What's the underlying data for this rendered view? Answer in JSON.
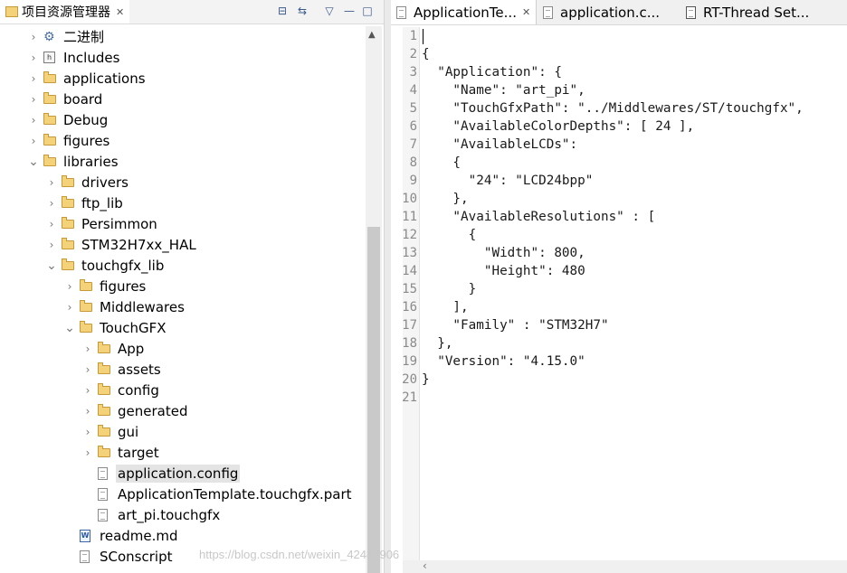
{
  "explorer": {
    "title": "项目资源管理器",
    "close_glyph": "✕",
    "toolbar": {
      "collapse_glyph": "⊟",
      "link_glyph": "⇆",
      "menu_glyph": "▽",
      "minimize_glyph": "—",
      "maximize_glyph": "□"
    },
    "items": [
      {
        "label": "二进制",
        "depth": 1,
        "expanded": false,
        "icon": "binaries-icon"
      },
      {
        "label": "Includes",
        "depth": 1,
        "expanded": false,
        "icon": "includes-icon"
      },
      {
        "label": "applications",
        "depth": 1,
        "expanded": false,
        "icon": "folder-icon"
      },
      {
        "label": "board",
        "depth": 1,
        "expanded": false,
        "icon": "folder-icon"
      },
      {
        "label": "Debug",
        "depth": 1,
        "expanded": false,
        "icon": "folder-icon"
      },
      {
        "label": "figures",
        "depth": 1,
        "expanded": false,
        "icon": "folder-icon"
      },
      {
        "label": "libraries",
        "depth": 1,
        "expanded": true,
        "icon": "folder-icon"
      },
      {
        "label": "drivers",
        "depth": 2,
        "expanded": false,
        "icon": "folder-icon"
      },
      {
        "label": "ftp_lib",
        "depth": 2,
        "expanded": false,
        "icon": "folder-icon"
      },
      {
        "label": "Persimmon",
        "depth": 2,
        "expanded": false,
        "icon": "folder-icon"
      },
      {
        "label": "STM32H7xx_HAL",
        "depth": 2,
        "expanded": false,
        "icon": "folder-icon"
      },
      {
        "label": "touchgfx_lib",
        "depth": 2,
        "expanded": true,
        "icon": "folder-icon"
      },
      {
        "label": "figures",
        "depth": 3,
        "expanded": false,
        "icon": "folder-icon"
      },
      {
        "label": "Middlewares",
        "depth": 3,
        "expanded": false,
        "icon": "folder-icon"
      },
      {
        "label": "TouchGFX",
        "depth": 3,
        "expanded": true,
        "icon": "folder-icon"
      },
      {
        "label": "App",
        "depth": 4,
        "expanded": false,
        "icon": "folder-icon"
      },
      {
        "label": "assets",
        "depth": 4,
        "expanded": false,
        "icon": "folder-icon"
      },
      {
        "label": "config",
        "depth": 4,
        "expanded": false,
        "icon": "folder-icon"
      },
      {
        "label": "generated",
        "depth": 4,
        "expanded": false,
        "icon": "folder-icon"
      },
      {
        "label": "gui",
        "depth": 4,
        "expanded": false,
        "icon": "folder-icon"
      },
      {
        "label": "target",
        "depth": 4,
        "expanded": false,
        "icon": "folder-icon"
      },
      {
        "label": "application.config",
        "depth": 4,
        "leaf": true,
        "selected": true,
        "icon": "file-icon"
      },
      {
        "label": "ApplicationTemplate.touchgfx.part",
        "depth": 4,
        "leaf": true,
        "icon": "file-icon"
      },
      {
        "label": "art_pi.touchgfx",
        "depth": 4,
        "leaf": true,
        "icon": "file-icon"
      },
      {
        "label": "readme.md",
        "depth": 3,
        "leaf": true,
        "icon": "word-file-icon"
      },
      {
        "label": "SConscript",
        "depth": 3,
        "leaf": true,
        "icon": "file-icon"
      }
    ]
  },
  "editor": {
    "tabs": [
      {
        "label": "ApplicationTe...",
        "active": true,
        "closable": true,
        "icon": "file-icon"
      },
      {
        "label": "application.c...",
        "active": false,
        "closable": false,
        "icon": "file-icon"
      },
      {
        "label": "RT-Thread Set...",
        "active": false,
        "closable": false,
        "icon": "settings-icon"
      }
    ],
    "lines": [
      "",
      "{",
      "  \"Application\": {",
      "    \"Name\": \"art_pi\",",
      "    \"TouchGfxPath\": \"../Middlewares/ST/touchgfx\",",
      "    \"AvailableColorDepths\": [ 24 ],",
      "    \"AvailableLCDs\":",
      "    {",
      "      \"24\": \"LCD24bpp\"",
      "    },",
      "    \"AvailableResolutions\" : [",
      "      {",
      "        \"Width\": 800,",
      "        \"Height\": 480",
      "      }",
      "    ],",
      "    \"Family\" : \"STM32H7\"",
      "  },",
      "  \"Version\": \"4.15.0\"",
      "}",
      ""
    ]
  },
  "watermark": "https://blog.csdn.net/weixin_42487906",
  "colors": {
    "folder": "#f3d27a",
    "selection": "#e4e4e4",
    "line_numbers": "#8a8a8a"
  }
}
